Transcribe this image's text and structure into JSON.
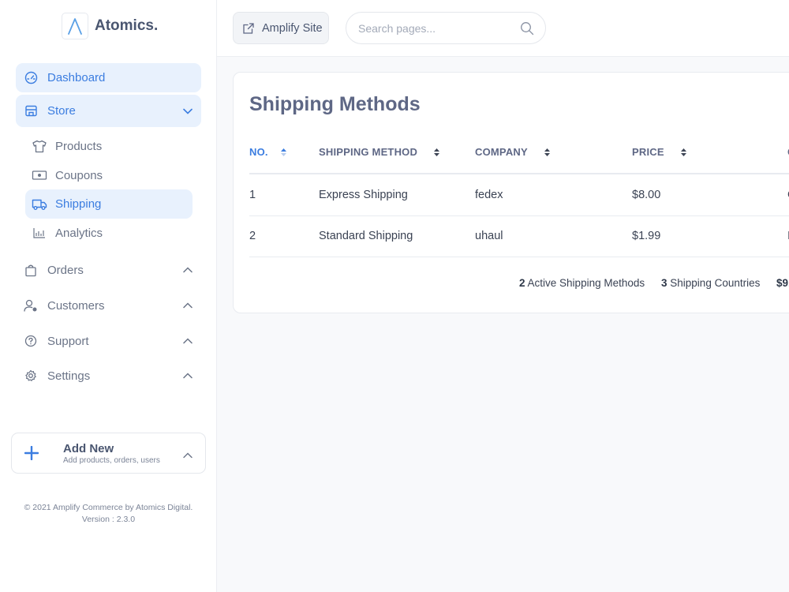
{
  "brand": {
    "name": "Atomics."
  },
  "sidebar": {
    "items": [
      {
        "label": "Dashboard"
      },
      {
        "label": "Store"
      },
      {
        "label": "Orders"
      },
      {
        "label": "Customers"
      },
      {
        "label": "Support"
      },
      {
        "label": "Settings"
      }
    ],
    "store_sub": [
      {
        "label": "Products"
      },
      {
        "label": "Coupons"
      },
      {
        "label": "Shipping"
      },
      {
        "label": "Analytics"
      }
    ]
  },
  "add_new": {
    "title": "Add New",
    "subtitle": "Add products, orders, users"
  },
  "footer": {
    "copyright": "© 2021 Amplify Commerce by Atomics Digital.",
    "version": "Version : 2.3.0"
  },
  "topbar": {
    "amplify_label": "Amplify Site",
    "search_placeholder": "Search pages..."
  },
  "card": {
    "title": "Shipping Methods",
    "columns": [
      "NO.",
      "SHIPPING METHOD",
      "COMPANY",
      "PRICE",
      "C"
    ],
    "rows": [
      {
        "no": "1",
        "method": "Express Shipping",
        "company": "fedex",
        "price": "$8.00",
        "extra": "C"
      },
      {
        "no": "2",
        "method": "Standard Shipping",
        "company": "uhaul",
        "price": "$1.99",
        "extra": "I"
      }
    ],
    "summary": {
      "active_count": "2",
      "active_label": "Active Shipping Methods",
      "countries_count": "3",
      "countries_label": "Shipping Countries",
      "total": "$9."
    }
  },
  "colors": {
    "accent": "#3b7de0",
    "active_bg": "#e8f1fd",
    "text": "#5e6785"
  }
}
